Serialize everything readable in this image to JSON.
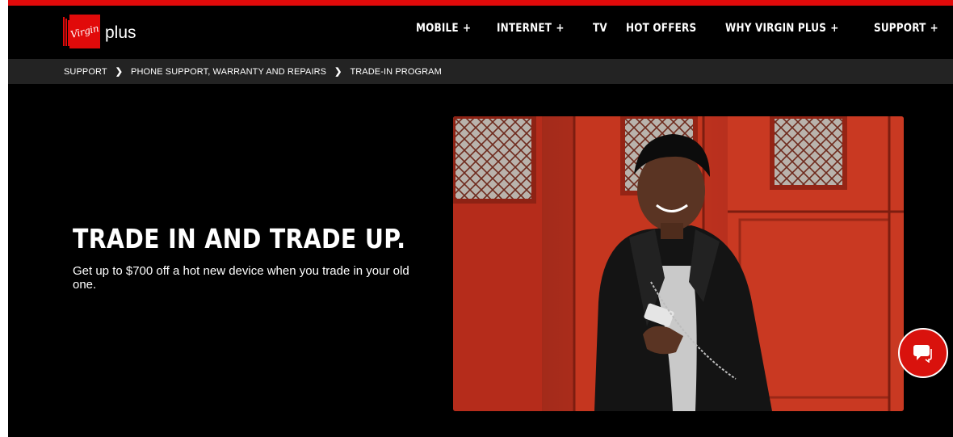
{
  "brand": {
    "wordmark": "plus",
    "logo_script": "Virgin",
    "color": "#e10a0a"
  },
  "nav": [
    {
      "label": "MOBILE",
      "expand": "+"
    },
    {
      "label": "INTERNET",
      "expand": "+"
    },
    {
      "label": "TV"
    },
    {
      "label": "HOT OFFERS"
    },
    {
      "label": "WHY VIRGIN PLUS",
      "expand": "+"
    },
    {
      "label": "SUPPORT",
      "expand": "+"
    }
  ],
  "breadcrumb": {
    "items": [
      "SUPPORT",
      "PHONE SUPPORT, WARRANTY AND REPAIRS",
      "TRADE-IN PROGRAM"
    ],
    "separator": "❯"
  },
  "hero": {
    "title": "TRADE IN AND TRADE UP.",
    "subtitle": "Get up to $700 off a hot new device when you trade in your old one."
  },
  "chat": {
    "icon": "chat-bubble-icon",
    "color": "#d9120d"
  },
  "colors": {
    "background": "#000000",
    "breadcrumb_bar": "#232323",
    "accent": "#e10a0a"
  }
}
